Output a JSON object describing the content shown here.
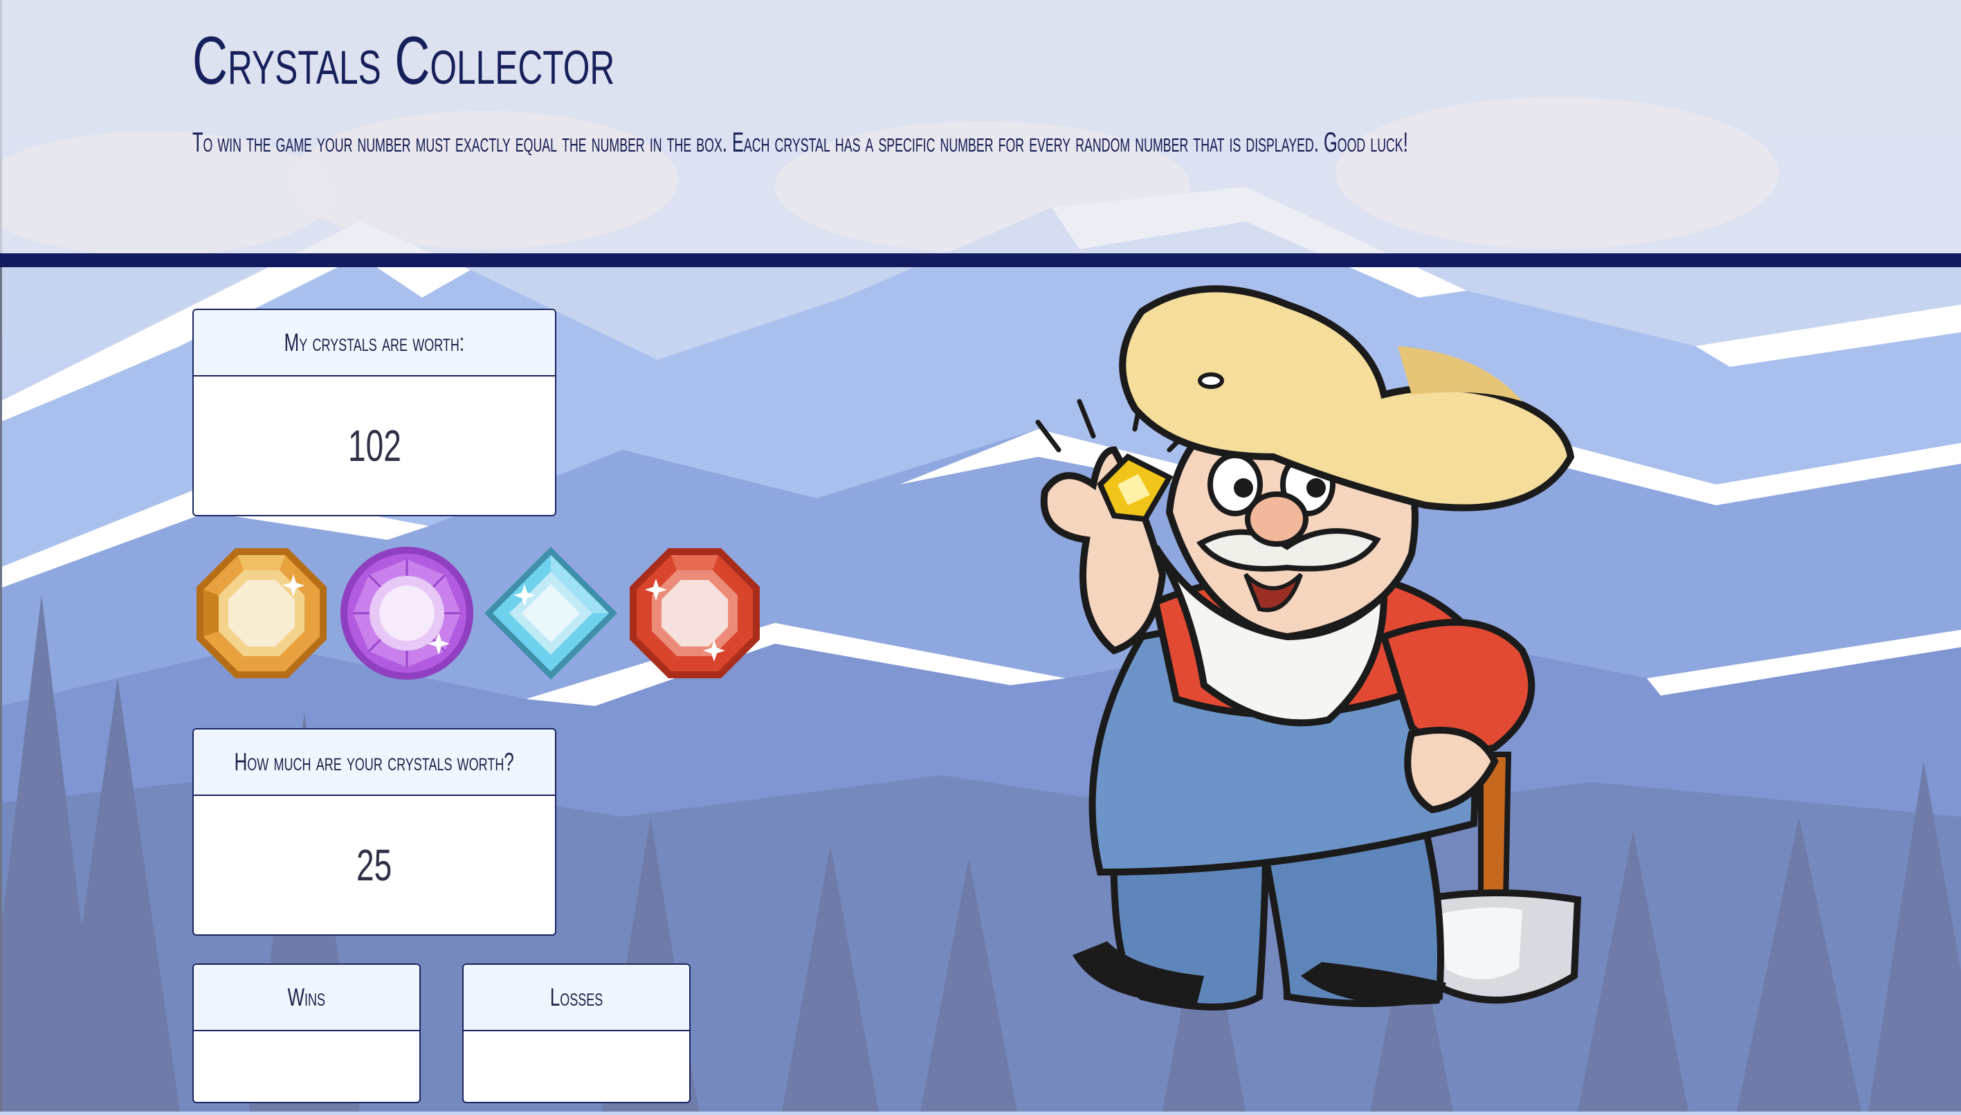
{
  "app": {
    "title": "Crystals Collector",
    "instructions": "To win the game your number must exactly equal the number in the box. Each crystal has a specific number for every random number that is displayed. Good luck!"
  },
  "target": {
    "label": "My crystals are worth:",
    "value": "102"
  },
  "score": {
    "label": "How much are your crystals worth?",
    "value": "25"
  },
  "wins": {
    "label": "Wins",
    "value": ""
  },
  "losses": {
    "label": "Losses",
    "value": ""
  },
  "crystals": [
    {
      "icon": "octagon-gold-crystal-icon",
      "color": "#e7a13f"
    },
    {
      "icon": "round-purple-crystal-icon",
      "color": "#b35be0"
    },
    {
      "icon": "diamond-blue-crystal-icon",
      "color": "#6ed2ee"
    },
    {
      "icon": "octagon-red-crystal-icon",
      "color": "#d8452c"
    }
  ],
  "colors": {
    "navy": "#131a5e",
    "panel_header": "#f0f6fd",
    "panel_border": "#1b255f",
    "sky": "#c4d3ef",
    "mountain": "#8aa3dc",
    "tree": "#6f7ba8"
  },
  "mascot": {
    "icon": "gold-prospector-mascot-icon"
  }
}
